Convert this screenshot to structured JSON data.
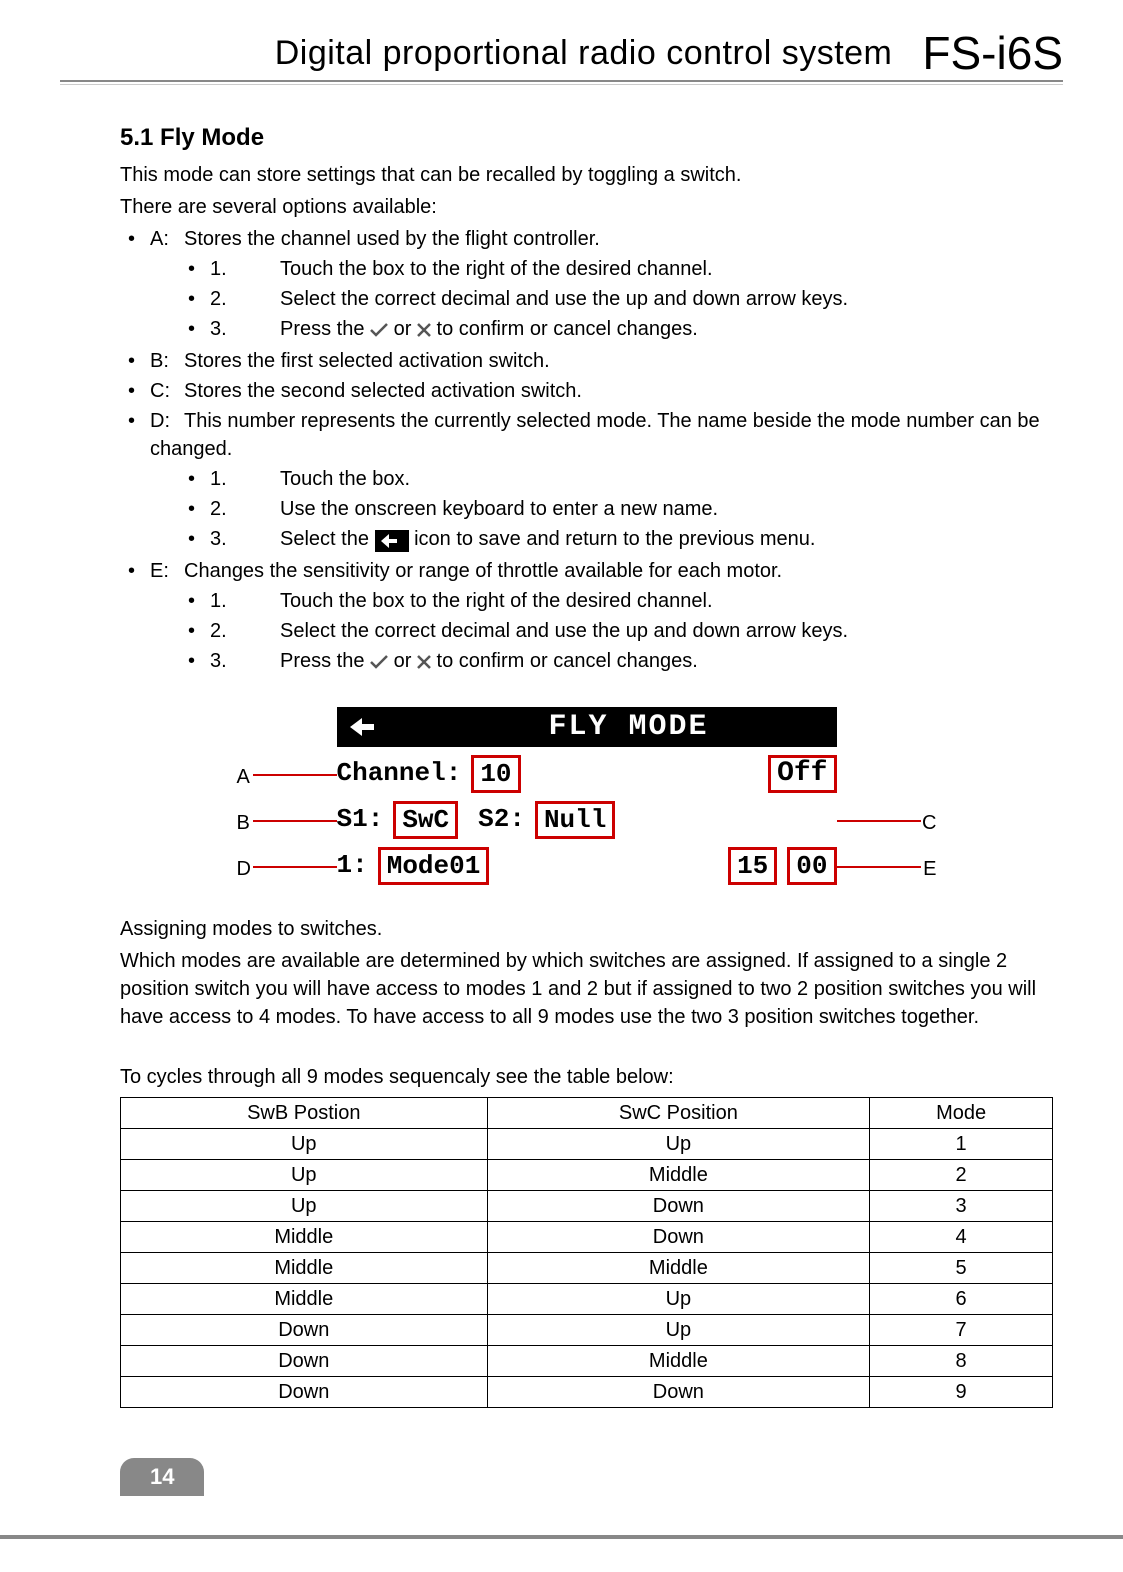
{
  "header": {
    "title": "Digital proportional radio control system",
    "logo": "FS-i6S"
  },
  "section": {
    "number": "5.1",
    "title": "Fly Mode",
    "intro1": "This mode can store settings that can be recalled by toggling a switch.",
    "intro2": "There are several options available:",
    "items": {
      "A": {
        "key": "A:",
        "text": "Stores the channel used by the flight controller.",
        "steps": {
          "s1": {
            "n": "1.",
            "t": "Touch the box to the right of the desired channel."
          },
          "s2": {
            "n": "2.",
            "t": "Select the correct decimal and use the up and down arrow keys."
          },
          "s3": {
            "n": "3.",
            "pre": "Press the ",
            "mid": " or ",
            "post": " to confirm or cancel changes."
          }
        }
      },
      "B": {
        "key": "B:",
        "text": "Stores the first selected activation switch."
      },
      "C": {
        "key": "C:",
        "text": "Stores the second selected activation switch."
      },
      "D": {
        "key": "D:",
        "text": "This number represents the currently selected mode. The name beside the mode number can be changed.",
        "steps": {
          "s1": {
            "n": "1.",
            "t": "Touch the box."
          },
          "s2": {
            "n": "2.",
            "t": "Use the onscreen keyboard to enter a new name."
          },
          "s3": {
            "n": "3.",
            "pre": "Select the ",
            "post": " icon to save and return to the previous menu."
          }
        }
      },
      "E": {
        "key": "E:",
        "text": "Changes the sensitivity or range of throttle available for each motor.",
        "steps": {
          "s1": {
            "n": "1.",
            "t": "Touch the box to the right of the desired channel."
          },
          "s2": {
            "n": "2.",
            "t": "Select the correct decimal and use the up and down arrow keys."
          },
          "s3": {
            "n": "3.",
            "pre": "Press the ",
            "mid": " or ",
            "post": " to confirm or cancel changes."
          }
        }
      }
    }
  },
  "lcd": {
    "title": "FLY MODE",
    "row1": {
      "channel_label": "Channel:",
      "channel_val": "10",
      "off": "Off"
    },
    "row2": {
      "s1_label": "S1:",
      "s1_val": "SwC",
      "s2_label": "S2:",
      "s2_val": "Null"
    },
    "row3": {
      "mode_label": "1:",
      "mode_val": "Mode01",
      "v1": "15",
      "v2": "00"
    },
    "callouts": {
      "A": "A",
      "B": "B",
      "C": "C",
      "D": "D",
      "E": "E"
    }
  },
  "assigning": {
    "h": "Assigning modes to switches.",
    "p": "Which modes are available are determined by which switches are assigned. If assigned to a single 2 position switch you will have access to modes 1 and 2 but if assigned to two 2 position switches you will have access to 4 modes. To have access to all 9 modes use the two 3 position switches together.",
    "tableintro": "To cycles through all 9 modes sequencaly see the table below:"
  },
  "chart_data": {
    "type": "table",
    "title": "Mode switch positions",
    "columns": [
      "SwB Postion",
      "SwC Position",
      "Mode"
    ],
    "rows": [
      [
        "Up",
        "Up",
        "1"
      ],
      [
        "Up",
        "Middle",
        "2"
      ],
      [
        "Up",
        "Down",
        "3"
      ],
      [
        "Middle",
        "Down",
        "4"
      ],
      [
        "Middle",
        "Middle",
        "5"
      ],
      [
        "Middle",
        "Up",
        "6"
      ],
      [
        "Down",
        "Up",
        "7"
      ],
      [
        "Down",
        "Middle",
        "8"
      ],
      [
        "Down",
        "Down",
        "9"
      ]
    ]
  },
  "page_number": "14"
}
